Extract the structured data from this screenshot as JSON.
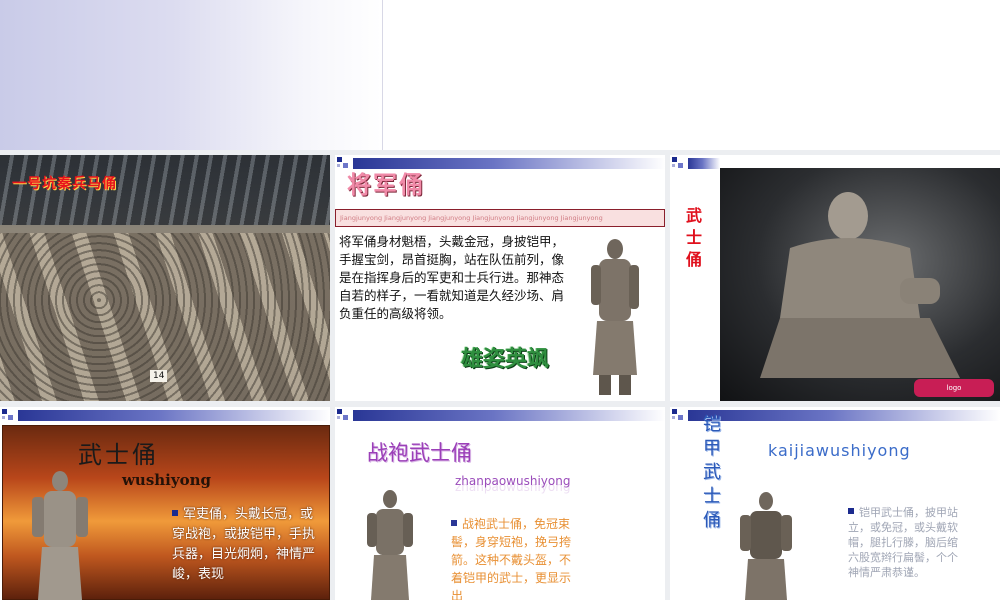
{
  "slides": {
    "s1": {
      "title": "一号坑秦兵马俑",
      "badge": "14"
    },
    "s2": {
      "title": "将军俑",
      "pinyin": "Jiangjunyong Jiangjunyong Jiangjunyong Jiangjunyong Jiangjunyong Jiangjunyong",
      "body": "将军俑身材魁梧，头戴金冠，身披铠甲，手握宝剑，昂首挺胸，站在队伍前列，像是在指挥身后的军吏和士兵行进。那神态自若的样子，一看就知道是久经沙场、肩负重任的高级将领。",
      "slogan": "雄姿英飒"
    },
    "s3": {
      "vertical_title": "武士俑"
    },
    "s4": {
      "title": "武士俑",
      "pinyin": "wushiyong",
      "bullet": "军吏俑，头戴长冠，或穿战袍，或披铠甲，手执兵器，目光炯炯，神情严峻，表现"
    },
    "s5": {
      "title": "战袍武士俑",
      "pinyin": "zhanpaowushiyong",
      "bullet": "战袍武士俑，免冠束髻，身穿短袍，挽弓挎箭。这种不戴头盔，不着铠甲的武士，更显示出"
    },
    "s6": {
      "vertical_title": "铠甲武士俑",
      "pinyin": "kaijiawushiyong",
      "bullet": "铠甲武士俑，披甲站立，或免冠，或头戴软帽，腿扎行滕，脑后绾六股宽辫行扁髻，个个神情严肃恭谨。"
    }
  },
  "colors": {
    "accent": "#1b2a8e",
    "title_red": "#e0101d"
  }
}
